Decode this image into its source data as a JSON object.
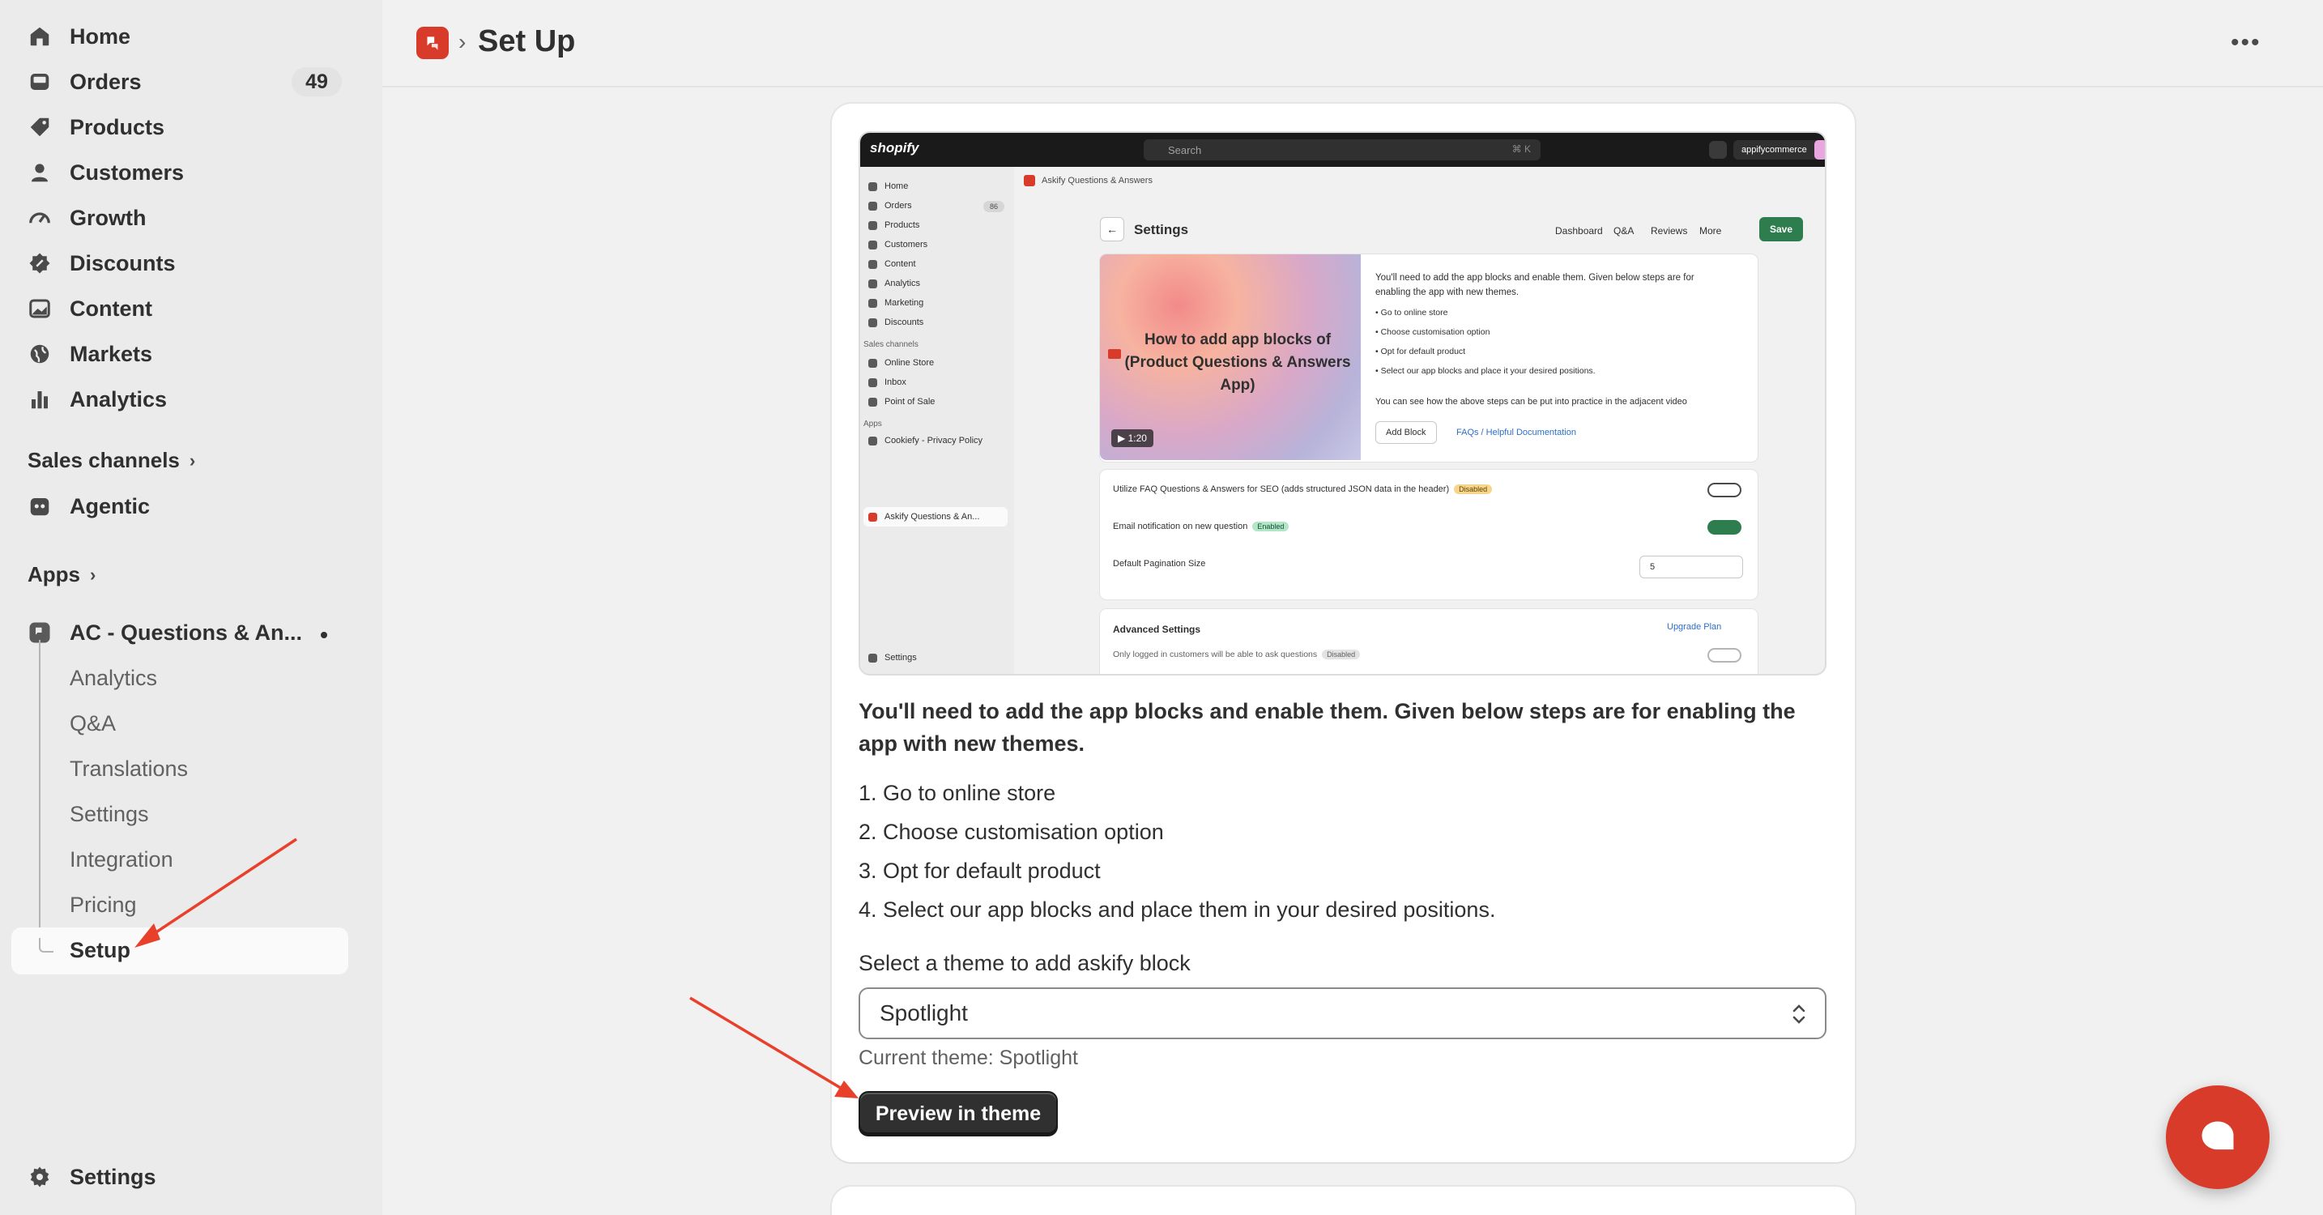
{
  "sidebar": {
    "items": [
      {
        "label": "Home",
        "icon": "home-icon"
      },
      {
        "label": "Orders",
        "icon": "orders-icon",
        "badge": "49"
      },
      {
        "label": "Products",
        "icon": "tag-icon"
      },
      {
        "label": "Customers",
        "icon": "person-icon"
      },
      {
        "label": "Growth",
        "icon": "gauge-icon"
      },
      {
        "label": "Discounts",
        "icon": "discount-icon"
      },
      {
        "label": "Content",
        "icon": "image-icon"
      },
      {
        "label": "Markets",
        "icon": "globe-icon"
      },
      {
        "label": "Analytics",
        "icon": "bar-chart-icon"
      }
    ],
    "sales_channels_label": "Sales channels",
    "agentic_label": "Agentic",
    "apps_label": "Apps",
    "app_name": "AC - Questions & An...",
    "app_subitems": [
      "Analytics",
      "Q&A",
      "Translations",
      "Settings",
      "Integration",
      "Pricing",
      "Setup"
    ],
    "settings_label": "Settings"
  },
  "header": {
    "title": "Set Up"
  },
  "screenshot": {
    "brand": "shopify",
    "search_placeholder": "Search",
    "search_shortcut": "⌘ K",
    "store_name": "appifycommerce",
    "side_items": [
      "Home",
      "Orders",
      "Products",
      "Customers",
      "Content",
      "Analytics",
      "Marketing",
      "Discounts"
    ],
    "orders_count": "86",
    "sales_channels": "Sales channels",
    "channels": [
      "Online Store",
      "Inbox",
      "Point of Sale"
    ],
    "apps": "Apps",
    "app_items": [
      "Cookiefy - Privacy Policy",
      "Askify Questions & An..."
    ],
    "side_settings": "Settings",
    "app_header": "Askify Questions & Answers",
    "page_title": "Settings",
    "nav_links": [
      "Dashboard",
      "Q&A",
      "Reviews",
      "More"
    ],
    "save": "Save",
    "video_title": "How to add app blocks of (Product Questions & Answers App)",
    "video_time": "1:20",
    "panel_intro": "You'll need to add the app blocks and enable them. Given below steps are for enabling the app with new themes.",
    "panel_steps": [
      "Go to online store",
      "Choose customisation option",
      "Opt for default product",
      "Select our app blocks and place it your desired positions."
    ],
    "panel_note": "You can see how the above steps can be put into practice in the adjacent video",
    "add_block": "Add Block",
    "faq_link": "FAQs / Helpful Documentation",
    "seo_label": "Utilize FAQ Questions & Answers for SEO (adds structured JSON data in the header)",
    "seo_tag": "Disabled",
    "seo_toggle": "OFF",
    "email_label": "Email notification on new question",
    "email_tag": "Enabled",
    "email_toggle": "ON",
    "pagination_label": "Default Pagination Size",
    "pagination_value": "5",
    "advanced_label": "Advanced Settings",
    "upgrade_link": "Upgrade Plan",
    "logged_in_label": "Only logged in customers will be able to ask questions",
    "logged_in_tag": "Disabled"
  },
  "main": {
    "intro": "You'll need to add the app blocks and enable them. Given below steps are for enabling the app with new themes.",
    "steps": [
      "1. Go to online store",
      "2. Choose customisation option",
      "3. Opt for default product",
      "4. Select our app blocks and place them in your desired positions."
    ],
    "select_label": "Select a theme to add askify block",
    "selected_theme": "Spotlight",
    "current_theme": "Current theme: Spotlight",
    "preview_button": "Preview in theme"
  },
  "colors": {
    "accent": "#d93b2b",
    "button_dark": "#303030",
    "arrow": "#e8402a"
  }
}
